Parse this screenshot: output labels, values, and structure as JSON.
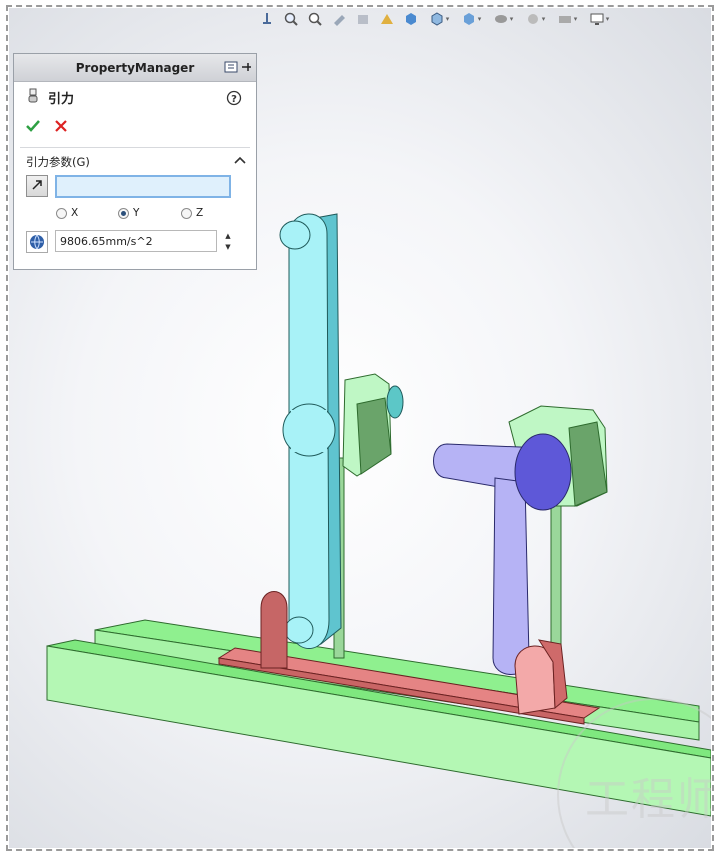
{
  "property_manager": {
    "header_title": "PropertyManager",
    "feature_name": "引力",
    "group_title": "引力参数(G)",
    "direction_reference_value": "",
    "axes": [
      {
        "label": "X",
        "selected": false
      },
      {
        "label": "Y",
        "selected": true
      },
      {
        "label": "Z",
        "selected": false
      }
    ],
    "gravity_value": "9806.65mm/s^2"
  },
  "heads_up_toolbar": {
    "icons": [
      "view-orientation-icon",
      "zoom-to-fit-icon",
      "zoom-to-area-icon",
      "previous-view-icon",
      "section-view-icon",
      "dynamic-annotation-icon",
      "view-cube-icon",
      "display-style-icon",
      "hide-show-icon",
      "edit-appearance-icon",
      "apply-scene-icon",
      "view-settings-icon",
      "display-icon"
    ]
  },
  "watermark": {
    "text": "工程师"
  },
  "colors": {
    "rail_green": "#8ff08f",
    "arm_cyan": "#a8f2f7",
    "arm_purple": "#b6b3f5",
    "slider_red": "#e88080",
    "hub_green": "#bff7c5",
    "accent_blue": "#7fb3e6"
  }
}
